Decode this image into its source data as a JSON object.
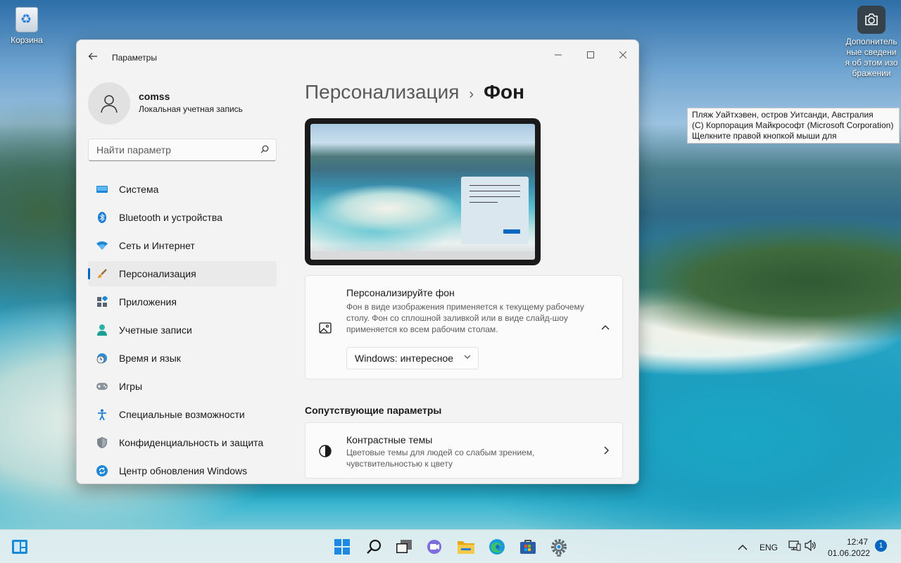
{
  "desktop": {
    "recycle_bin_label": "Корзина",
    "spotlight_label": "Дополнительные сведения об этом изображении",
    "tooltip_lines": [
      "Пляж Уайтхэвен, остров Уитсанди, Австралия",
      "(C) Корпорация Майкрософт (Microsoft Corporation)",
      "Щелкните правой кнопкой мыши для"
    ]
  },
  "window": {
    "title": "Параметры",
    "back_icon": "arrow-left-icon",
    "controls": [
      "minimize",
      "maximize",
      "close"
    ]
  },
  "profile": {
    "name": "comss",
    "account_type": "Локальная учетная запись"
  },
  "search": {
    "placeholder": "Найти параметр"
  },
  "nav": {
    "items": [
      {
        "label": "Система",
        "icon": "display-icon",
        "active": false
      },
      {
        "label": "Bluetooth и устройства",
        "icon": "bluetooth-icon",
        "active": false
      },
      {
        "label": "Сеть и Интернет",
        "icon": "wifi-icon",
        "active": false
      },
      {
        "label": "Персонализация",
        "icon": "brush-icon",
        "active": true
      },
      {
        "label": "Приложения",
        "icon": "apps-icon",
        "active": false
      },
      {
        "label": "Учетные записи",
        "icon": "person-icon",
        "active": false
      },
      {
        "label": "Время и язык",
        "icon": "globe-clock-icon",
        "active": false
      },
      {
        "label": "Игры",
        "icon": "gamepad-icon",
        "active": false
      },
      {
        "label": "Специальные возможности",
        "icon": "accessibility-icon",
        "active": false
      },
      {
        "label": "Конфиденциальность и защита",
        "icon": "shield-icon",
        "active": false
      },
      {
        "label": "Центр обновления Windows",
        "icon": "update-icon",
        "active": false
      }
    ]
  },
  "content": {
    "breadcrumb_parent": "Персонализация",
    "breadcrumb_separator": "›",
    "breadcrumb_current": "Фон",
    "background_card": {
      "title": "Персонализируйте фон",
      "description": "Фон в виде изображения применяется к текущему рабочему столу. Фон со сплошной заливкой или в виде слайд-шоу применяется ко всем рабочим столам.",
      "dropdown_value": "Windows: интересное",
      "icon": "image-icon",
      "expanded": true
    },
    "related_title": "Сопутствующие параметры",
    "contrast_card": {
      "title": "Контрастные темы",
      "description": "Цветовые темы для людей со слабым зрением, чувствительностью к цвету",
      "icon": "contrast-icon"
    }
  },
  "taskbar": {
    "apps": [
      "start-icon",
      "search-icon",
      "task-view-icon",
      "chat-icon",
      "file-explorer-icon",
      "edge-icon",
      "store-icon",
      "settings-icon"
    ],
    "language": "ENG",
    "time": "12:47",
    "date": "01.06.2022",
    "notifications": "1"
  },
  "colors": {
    "accent": "#0067c0",
    "window_bg": "#f3f3f3",
    "card_bg": "#fbfbfb"
  }
}
